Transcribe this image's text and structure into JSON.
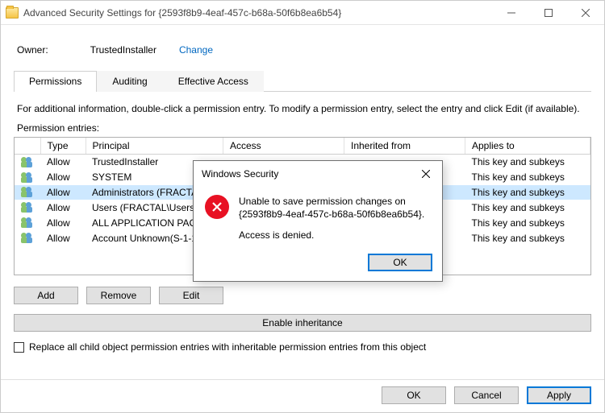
{
  "window": {
    "title": "Advanced Security Settings for {2593f8b9-4eaf-457c-b68a-50f6b8ea6b54}"
  },
  "owner": {
    "label": "Owner:",
    "value": "TrustedInstaller",
    "change": "Change"
  },
  "tabs": {
    "permissions": "Permissions",
    "auditing": "Auditing",
    "effective": "Effective Access"
  },
  "info": "For additional information, double-click a permission entry. To modify a permission entry, select the entry and click Edit (if available).",
  "entries_label": "Permission entries:",
  "columns": {
    "type": "Type",
    "principal": "Principal",
    "access": "Access",
    "inherited": "Inherited from",
    "applies": "Applies to"
  },
  "rows": [
    {
      "type": "Allow",
      "principal": "TrustedInstaller",
      "access": "",
      "inherited": "",
      "applies": "This key and subkeys"
    },
    {
      "type": "Allow",
      "principal": "SYSTEM",
      "access": "",
      "inherited": "",
      "applies": "This key and subkeys"
    },
    {
      "type": "Allow",
      "principal": "Administrators (FRACTAL\\",
      "access": "",
      "inherited": "",
      "applies": "This key and subkeys"
    },
    {
      "type": "Allow",
      "principal": "Users (FRACTAL\\Users)",
      "access": "",
      "inherited": "",
      "applies": "This key and subkeys"
    },
    {
      "type": "Allow",
      "principal": "ALL APPLICATION PACKAG",
      "access": "",
      "inherited": "",
      "applies": "This key and subkeys"
    },
    {
      "type": "Allow",
      "principal": "Account Unknown(S-1-15-",
      "access": "",
      "inherited": "",
      "applies": "This key and subkeys"
    }
  ],
  "selected_row": 2,
  "buttons": {
    "add": "Add",
    "remove": "Remove",
    "edit": "Edit",
    "enable": "Enable inheritance",
    "replace": "Replace all child object permission entries with inheritable permission entries from this object",
    "ok": "OK",
    "cancel": "Cancel",
    "apply": "Apply"
  },
  "modal": {
    "title": "Windows Security",
    "line1": "Unable to save permission changes on {2593f8b9-4eaf-457c-b68a-50f6b8ea6b54}.",
    "line2": "Access is denied.",
    "ok": "OK"
  }
}
